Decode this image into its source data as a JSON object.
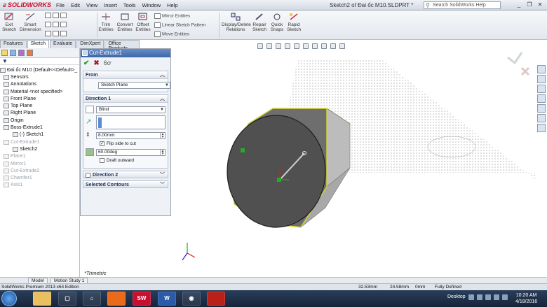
{
  "app": {
    "logo": "SOLIDWORKS",
    "window_title": "Sketch2 of Đai ốc M10.SLDPRT *",
    "search_placeholder": "Search SolidWorks Help",
    "menu": [
      "File",
      "Edit",
      "View",
      "Insert",
      "Tools",
      "Window",
      "Help"
    ]
  },
  "ribbon": {
    "exit_sketch": "Exit Sketch",
    "smart_dimension": "Smart Dimension",
    "trim_entities": "Trim Entities",
    "convert_entities": "Convert Entities",
    "offset_entities": "Offset Entities",
    "mirror_entities": "Mirror Entities",
    "linear_sketch_pattern": "Linear Sketch Pattern",
    "move_entities": "Move Entities",
    "display_delete_relations": "Display/Delete Relations",
    "repair_sketch": "Repair Sketch",
    "quick_snaps": "Quick Snaps",
    "rapid_sketch": "Rapid Sketch"
  },
  "tabs": [
    "Features",
    "Sketch",
    "Evaluate",
    "DimXpert",
    "Office Products"
  ],
  "tree": {
    "items": [
      {
        "label": "Đai ốc M10  (Default<<Default>_",
        "dim": false
      },
      {
        "label": "Sensors",
        "dim": false
      },
      {
        "label": "Annotations",
        "dim": false
      },
      {
        "label": "Material <not specified>",
        "dim": false
      },
      {
        "label": "Front Plane",
        "dim": false
      },
      {
        "label": "Top Plane",
        "dim": false
      },
      {
        "label": "Right Plane",
        "dim": false
      },
      {
        "label": "Origin",
        "dim": false
      },
      {
        "label": "Boss-Extrude1",
        "dim": false
      },
      {
        "label": "(-) Sketch1",
        "dim": false
      },
      {
        "label": "Cut-Extrude1",
        "dim": true
      },
      {
        "label": "Sketch2",
        "dim": false
      },
      {
        "label": "Plane1",
        "dim": true
      },
      {
        "label": "Mirror1",
        "dim": true
      },
      {
        "label": "Cut-Extrude2",
        "dim": true
      },
      {
        "label": "Chamfer1",
        "dim": true
      },
      {
        "label": "Axis1",
        "dim": true
      }
    ]
  },
  "pm": {
    "title": "Cut-Extrude1",
    "from_label": "From",
    "from_value": "Sketch Plane",
    "direction1_label": "Direction 1",
    "end_condition": "Blind",
    "depth": "8.00mm",
    "flip_side": "Flip side to cut",
    "draft_angle": "60.00deg",
    "draft_outward": "Draft outward",
    "direction2_label": "Direction 2",
    "selected_contours": "Selected Contours"
  },
  "view": {
    "orientation": "*Trimetric"
  },
  "bottom_tabs": [
    "Model",
    "Motion Study 1"
  ],
  "status": {
    "edition": "SolidWorks Premium 2013 x64 Edition",
    "x": "32.53mm",
    "y": "24.58mm",
    "z": "0mm",
    "state": "Fully Defined"
  },
  "taskbar": {
    "desktop": "Desktop",
    "time": "10:20 AM",
    "date": "4/18/2016"
  }
}
